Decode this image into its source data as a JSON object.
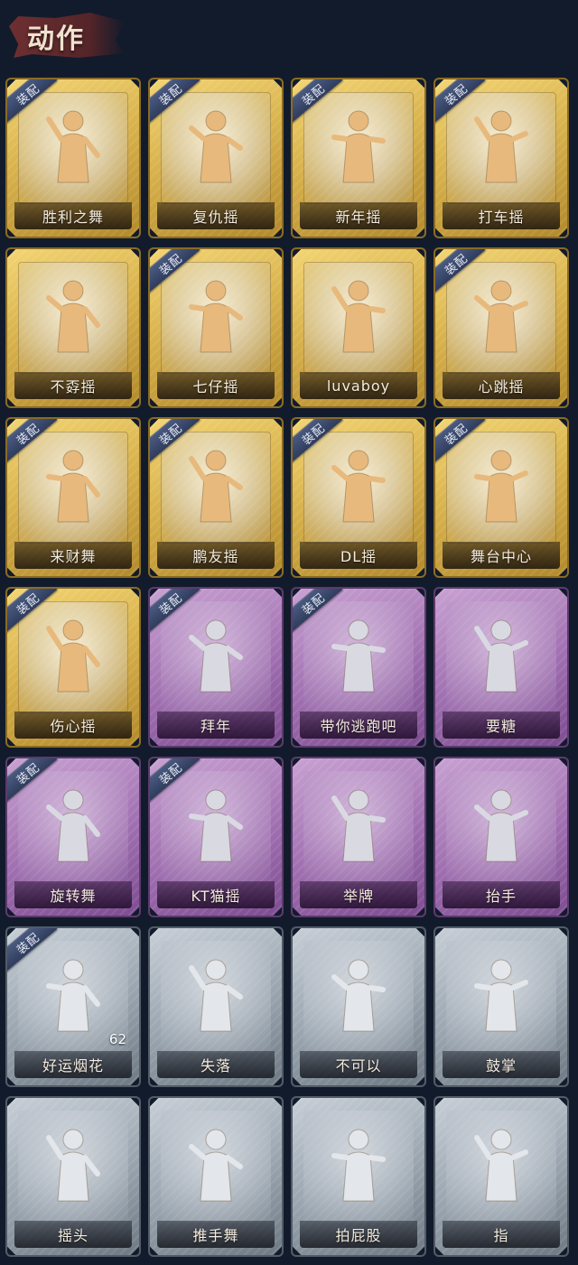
{
  "header": {
    "title": "动作"
  },
  "badge_label": "装配",
  "colors": {
    "gold": "#d8b24c",
    "purple": "#a06fb0",
    "silver": "#98a3ae",
    "background": "#121b2b"
  },
  "actions": [
    {
      "label": "胜利之舞",
      "rarity": "gold",
      "equipped": true,
      "icon": "victory-dance-figure-icon"
    },
    {
      "label": "复仇摇",
      "rarity": "gold",
      "equipped": true,
      "icon": "revenge-shake-figure-icon"
    },
    {
      "label": "新年摇",
      "rarity": "gold",
      "equipped": true,
      "icon": "new-year-shake-figure-icon"
    },
    {
      "label": "打车摇",
      "rarity": "gold",
      "equipped": true,
      "icon": "taxi-shake-figure-icon"
    },
    {
      "label": "不孬摇",
      "rarity": "gold",
      "equipped": false,
      "icon": "not-bad-shake-figure-icon"
    },
    {
      "label": "七仔摇",
      "rarity": "gold",
      "equipped": true,
      "icon": "qizai-shake-figure-icon"
    },
    {
      "label": "luvaboy",
      "rarity": "gold",
      "equipped": false,
      "icon": "luvaboy-figure-icon"
    },
    {
      "label": "心跳摇",
      "rarity": "gold",
      "equipped": true,
      "icon": "heartbeat-shake-figure-icon"
    },
    {
      "label": "来财舞",
      "rarity": "gold",
      "equipped": true,
      "icon": "fortune-dance-figure-icon"
    },
    {
      "label": "鹏友摇",
      "rarity": "gold",
      "equipped": true,
      "icon": "friend-shake-figure-icon"
    },
    {
      "label": "DL摇",
      "rarity": "gold",
      "equipped": true,
      "icon": "dl-shake-figure-icon"
    },
    {
      "label": "舞台中心",
      "rarity": "gold",
      "equipped": true,
      "icon": "center-stage-figure-icon"
    },
    {
      "label": "伤心摇",
      "rarity": "gold",
      "equipped": true,
      "icon": "heart-hands-figure-icon"
    },
    {
      "label": "拜年",
      "rarity": "purple",
      "equipped": true,
      "icon": "new-year-greeting-figure-icon"
    },
    {
      "label": "带你逃跑吧",
      "rarity": "purple",
      "equipped": true,
      "icon": "run-away-figure-icon"
    },
    {
      "label": "要糖",
      "rarity": "purple",
      "equipped": false,
      "icon": "ask-candy-figure-icon"
    },
    {
      "label": "旋转舞",
      "rarity": "purple",
      "equipped": true,
      "icon": "spin-dance-figure-icon"
    },
    {
      "label": "KT猫摇",
      "rarity": "purple",
      "equipped": true,
      "icon": "kt-cat-shake-figure-icon"
    },
    {
      "label": "举牌",
      "rarity": "purple",
      "equipped": false,
      "icon": "hold-sign-figure-icon"
    },
    {
      "label": "抬手",
      "rarity": "purple",
      "equipped": false,
      "icon": "raise-hand-figure-icon"
    },
    {
      "label": "好运烟花",
      "rarity": "silver",
      "equipped": true,
      "icon": "firework-icon",
      "count": "62"
    },
    {
      "label": "失落",
      "rarity": "silver",
      "equipped": false,
      "icon": "crawling-figure-icon"
    },
    {
      "label": "不可以",
      "rarity": "silver",
      "equipped": false,
      "icon": "finger-wag-icon"
    },
    {
      "label": "鼓掌",
      "rarity": "silver",
      "equipped": false,
      "icon": "clapping-hands-icon"
    },
    {
      "label": "摇头",
      "rarity": "silver",
      "equipped": false,
      "icon": "head-shake-figure-icon"
    },
    {
      "label": "推手舞",
      "rarity": "silver",
      "equipped": false,
      "icon": "push-hands-figure-icon"
    },
    {
      "label": "拍屁股",
      "rarity": "silver",
      "equipped": false,
      "icon": "butt-slap-figure-icon"
    },
    {
      "label": "指",
      "rarity": "silver",
      "equipped": false,
      "icon": "pointing-hand-icon"
    }
  ]
}
